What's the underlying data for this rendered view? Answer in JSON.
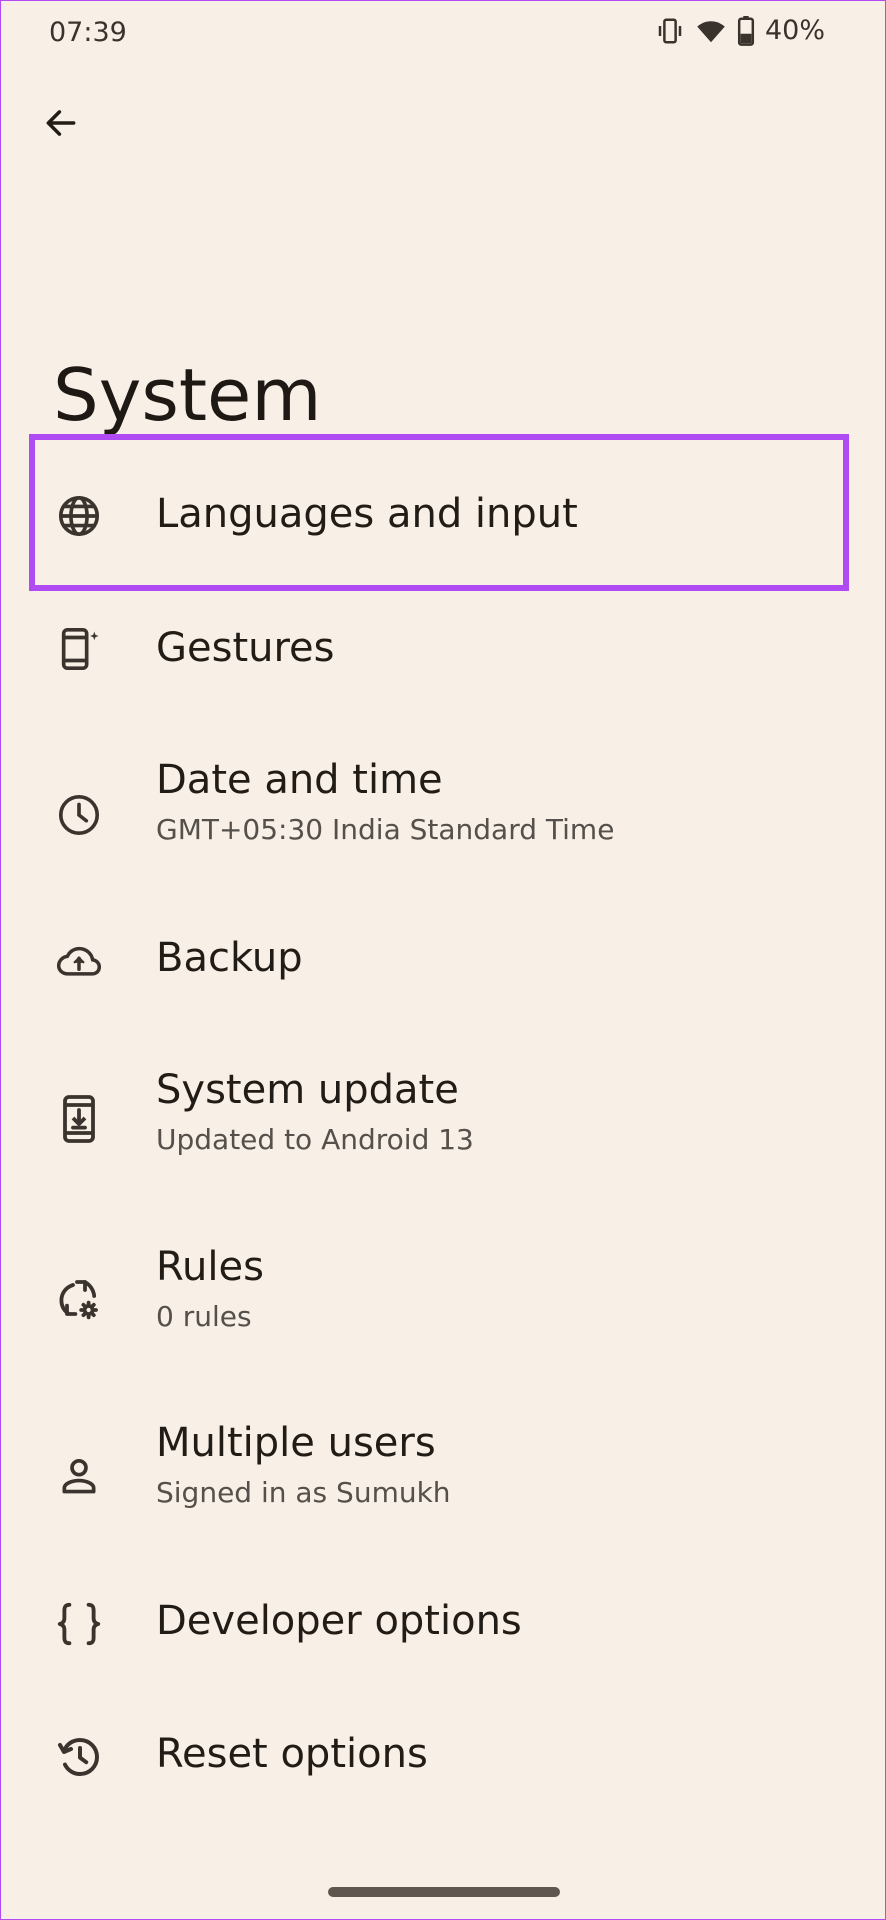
{
  "status_bar": {
    "time": "07:39",
    "battery_percent": "40%",
    "icons": [
      "vibrate-icon",
      "wifi-icon",
      "battery-icon"
    ]
  },
  "header": {
    "back_icon": "arrow-left-icon",
    "title": "System"
  },
  "highlight": {
    "color": "#b04af2",
    "target": "Languages and input"
  },
  "items": [
    {
      "icon": "globe-icon",
      "title": "Languages and input",
      "subtitle": ""
    },
    {
      "icon": "gestures-icon",
      "title": "Gestures",
      "subtitle": ""
    },
    {
      "icon": "clock-icon",
      "title": "Date and time",
      "subtitle": "GMT+05:30 India Standard Time"
    },
    {
      "icon": "cloud-upload-icon",
      "title": "Backup",
      "subtitle": ""
    },
    {
      "icon": "system-update-icon",
      "title": "System update",
      "subtitle": "Updated to Android 13"
    },
    {
      "icon": "rules-icon",
      "title": "Rules",
      "subtitle": "0 rules"
    },
    {
      "icon": "person-icon",
      "title": "Multiple users",
      "subtitle": "Signed in as Sumukh"
    },
    {
      "icon": "braces-icon",
      "title": "Developer options",
      "subtitle": ""
    },
    {
      "icon": "history-icon",
      "title": "Reset options",
      "subtitle": ""
    }
  ],
  "colors": {
    "background": "#f8f0e7",
    "text_primary": "#221c17",
    "text_secondary": "#55504b",
    "accent_highlight": "#b04af2"
  }
}
